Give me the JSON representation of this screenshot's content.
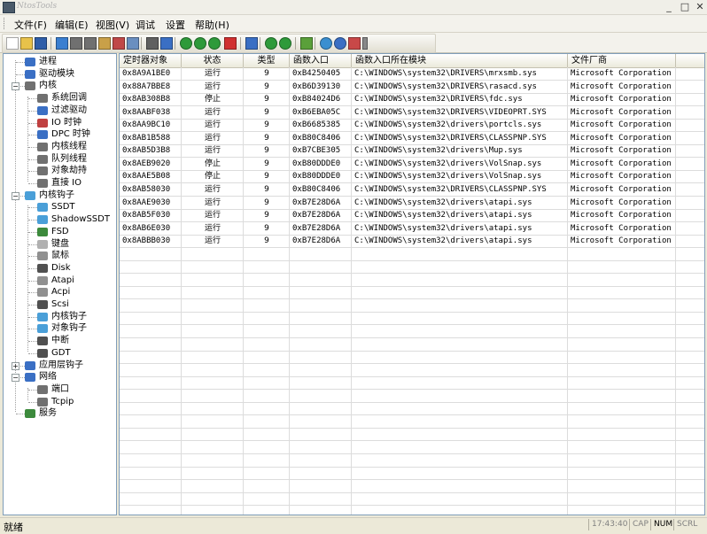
{
  "window": {
    "title": "NtosTools",
    "minimize": "_",
    "maximize": "□",
    "close": "✕"
  },
  "menu": [
    "文件(F)",
    "编辑(E)",
    "视图(V)",
    "调试",
    "设置",
    "帮助(H)"
  ],
  "toolbar": {
    "buttons": [
      "new-icon",
      "open-icon",
      "save-icon",
      "refresh-icon",
      "cut-icon",
      "copy-icon",
      "paste-icon",
      "export-icon",
      "properties-icon",
      "print-icon",
      "help-icon",
      "up-icon",
      "arrow-up-icon",
      "arrow-down-icon",
      "delete-icon",
      "search-icon",
      "run-icon",
      "pause-icon",
      "network-icon",
      "settings-icon",
      "info-icon",
      "color-icon",
      "dropdown-icon"
    ]
  },
  "tree": [
    {
      "label": "进程",
      "icon": "process-icon",
      "level": 1,
      "color": "#3a6fc4"
    },
    {
      "label": "驱动模块",
      "icon": "driver-icon",
      "level": 1,
      "color": "#3a6fc4"
    },
    {
      "label": "内核",
      "icon": "kernel-icon",
      "level": 1,
      "color": "#707070",
      "expander": "−"
    },
    {
      "label": "系统回调",
      "icon": "callback-icon",
      "level": 2,
      "color": "#707070"
    },
    {
      "label": "过滤驱动",
      "icon": "filter-icon",
      "level": 2,
      "color": "#3a6fc4"
    },
    {
      "label": "IO 时钟",
      "icon": "timer-icon",
      "level": 2,
      "color": "#c04040"
    },
    {
      "label": "DPC 时钟",
      "icon": "dpc-icon",
      "level": 2,
      "color": "#3a6fc4"
    },
    {
      "label": "内核线程",
      "icon": "thread-icon",
      "level": 2,
      "color": "#707070"
    },
    {
      "label": "队列线程",
      "icon": "queue-icon",
      "level": 2,
      "color": "#707070"
    },
    {
      "label": "对象劫持",
      "icon": "object-icon",
      "level": 2,
      "color": "#707070"
    },
    {
      "label": "直接 IO",
      "icon": "directio-icon",
      "level": 2,
      "color": "#707070"
    },
    {
      "label": "内核钩子",
      "icon": "hook-icon",
      "level": 1,
      "color": "#4a9fd8",
      "expander": "−"
    },
    {
      "label": "SSDT",
      "icon": "gear-icon",
      "level": 2,
      "color": "#4a9fd8"
    },
    {
      "label": "ShadowSSDT",
      "icon": "gear-icon",
      "level": 2,
      "color": "#4a9fd8"
    },
    {
      "label": "FSD",
      "icon": "disk-icon",
      "level": 2,
      "color": "#3c8a3c"
    },
    {
      "label": "键盘",
      "icon": "keyboard-icon",
      "level": 2,
      "color": "#b0b0b0"
    },
    {
      "label": "鼠标",
      "icon": "mouse-icon",
      "level": 2,
      "color": "#909090"
    },
    {
      "label": "Disk",
      "icon": "disk-drive-icon",
      "level": 2,
      "color": "#505050"
    },
    {
      "label": "Atapi",
      "icon": "atapi-icon",
      "level": 2,
      "color": "#909090"
    },
    {
      "label": "Acpi",
      "icon": "acpi-icon",
      "level": 2,
      "color": "#909090"
    },
    {
      "label": "Scsi",
      "icon": "scsi-icon",
      "level": 2,
      "color": "#505050"
    },
    {
      "label": "内核钩子",
      "icon": "gear-icon",
      "level": 2,
      "color": "#4a9fd8"
    },
    {
      "label": "对象钩子",
      "icon": "gear-icon",
      "level": 2,
      "color": "#4a9fd8"
    },
    {
      "label": "中断",
      "icon": "interrupt-icon",
      "level": 2,
      "color": "#505050"
    },
    {
      "label": "GDT",
      "icon": "gdt-icon",
      "level": 2,
      "color": "#505050"
    },
    {
      "label": "应用层钩子",
      "icon": "app-hook-icon",
      "level": 1,
      "color": "#3a6fc4",
      "expander": "+"
    },
    {
      "label": "网络",
      "icon": "network-icon",
      "level": 1,
      "color": "#3a6fc4",
      "expander": "−"
    },
    {
      "label": "端口",
      "icon": "port-icon",
      "level": 2,
      "color": "#707070"
    },
    {
      "label": "Tcpip",
      "icon": "tcpip-icon",
      "level": 2,
      "color": "#707070"
    },
    {
      "label": "服务",
      "icon": "service-icon",
      "level": 1,
      "color": "#3c8a3c"
    }
  ],
  "table": {
    "columns": [
      "定时器对象",
      "状态",
      "类型",
      "函数入口",
      "函数入口所在模块",
      "文件厂商"
    ],
    "rows": [
      [
        "0x8A9A1BE0",
        "运行",
        "9",
        "0xB4250405",
        "C:\\WINDOWS\\system32\\DRIVERS\\mrxsmb.sys",
        "Microsoft Corporation"
      ],
      [
        "0x88A7BBE8",
        "运行",
        "9",
        "0xB6D39130",
        "C:\\WINDOWS\\system32\\DRIVERS\\rasacd.sys",
        "Microsoft Corporation"
      ],
      [
        "0x8AB308B8",
        "停止",
        "9",
        "0xB84024D6",
        "C:\\WINDOWS\\system32\\DRIVERS\\fdc.sys",
        "Microsoft Corporation"
      ],
      [
        "0x8AABF038",
        "运行",
        "9",
        "0xB6EBA05C",
        "C:\\WINDOWS\\system32\\DRIVERS\\VIDEOPRT.SYS",
        "Microsoft Corporation"
      ],
      [
        "0x8AA9BC10",
        "运行",
        "9",
        "0xB6685385",
        "C:\\WINDOWS\\system32\\drivers\\portcls.sys",
        "Microsoft Corporation"
      ],
      [
        "0x8AB1B588",
        "运行",
        "9",
        "0xB80C8406",
        "C:\\WINDOWS\\system32\\DRIVERS\\CLASSPNP.SYS",
        "Microsoft Corporation"
      ],
      [
        "0x8AB5D3B8",
        "运行",
        "9",
        "0xB7CBE305",
        "C:\\WINDOWS\\system32\\drivers\\Mup.sys",
        "Microsoft Corporation"
      ],
      [
        "0x8AEB9020",
        "停止",
        "9",
        "0xB80DDDE0",
        "C:\\WINDOWS\\system32\\drivers\\VolSnap.sys",
        "Microsoft Corporation"
      ],
      [
        "0x8AAE5B08",
        "停止",
        "9",
        "0xB80DDDE0",
        "C:\\WINDOWS\\system32\\drivers\\VolSnap.sys",
        "Microsoft Corporation"
      ],
      [
        "0x8AB58030",
        "运行",
        "9",
        "0xB80C8406",
        "C:\\WINDOWS\\system32\\DRIVERS\\CLASSPNP.SYS",
        "Microsoft Corporation"
      ],
      [
        "0x8AAE9030",
        "运行",
        "9",
        "0xB7E28D6A",
        "C:\\WINDOWS\\system32\\drivers\\atapi.sys",
        "Microsoft Corporation"
      ],
      [
        "0x8AB5F030",
        "运行",
        "9",
        "0xB7E28D6A",
        "C:\\WINDOWS\\system32\\drivers\\atapi.sys",
        "Microsoft Corporation"
      ],
      [
        "0x8AB6E030",
        "运行",
        "9",
        "0xB7E28D6A",
        "C:\\WINDOWS\\system32\\drivers\\atapi.sys",
        "Microsoft Corporation"
      ],
      [
        "0x8ABBB030",
        "运行",
        "9",
        "0xB7E28D6A",
        "C:\\WINDOWS\\system32\\drivers\\atapi.sys",
        "Microsoft Corporation"
      ]
    ]
  },
  "status": {
    "text": "就绪",
    "time": "17:43:40",
    "cap": "CAP",
    "num": "NUM",
    "scrl": "SCRL"
  }
}
